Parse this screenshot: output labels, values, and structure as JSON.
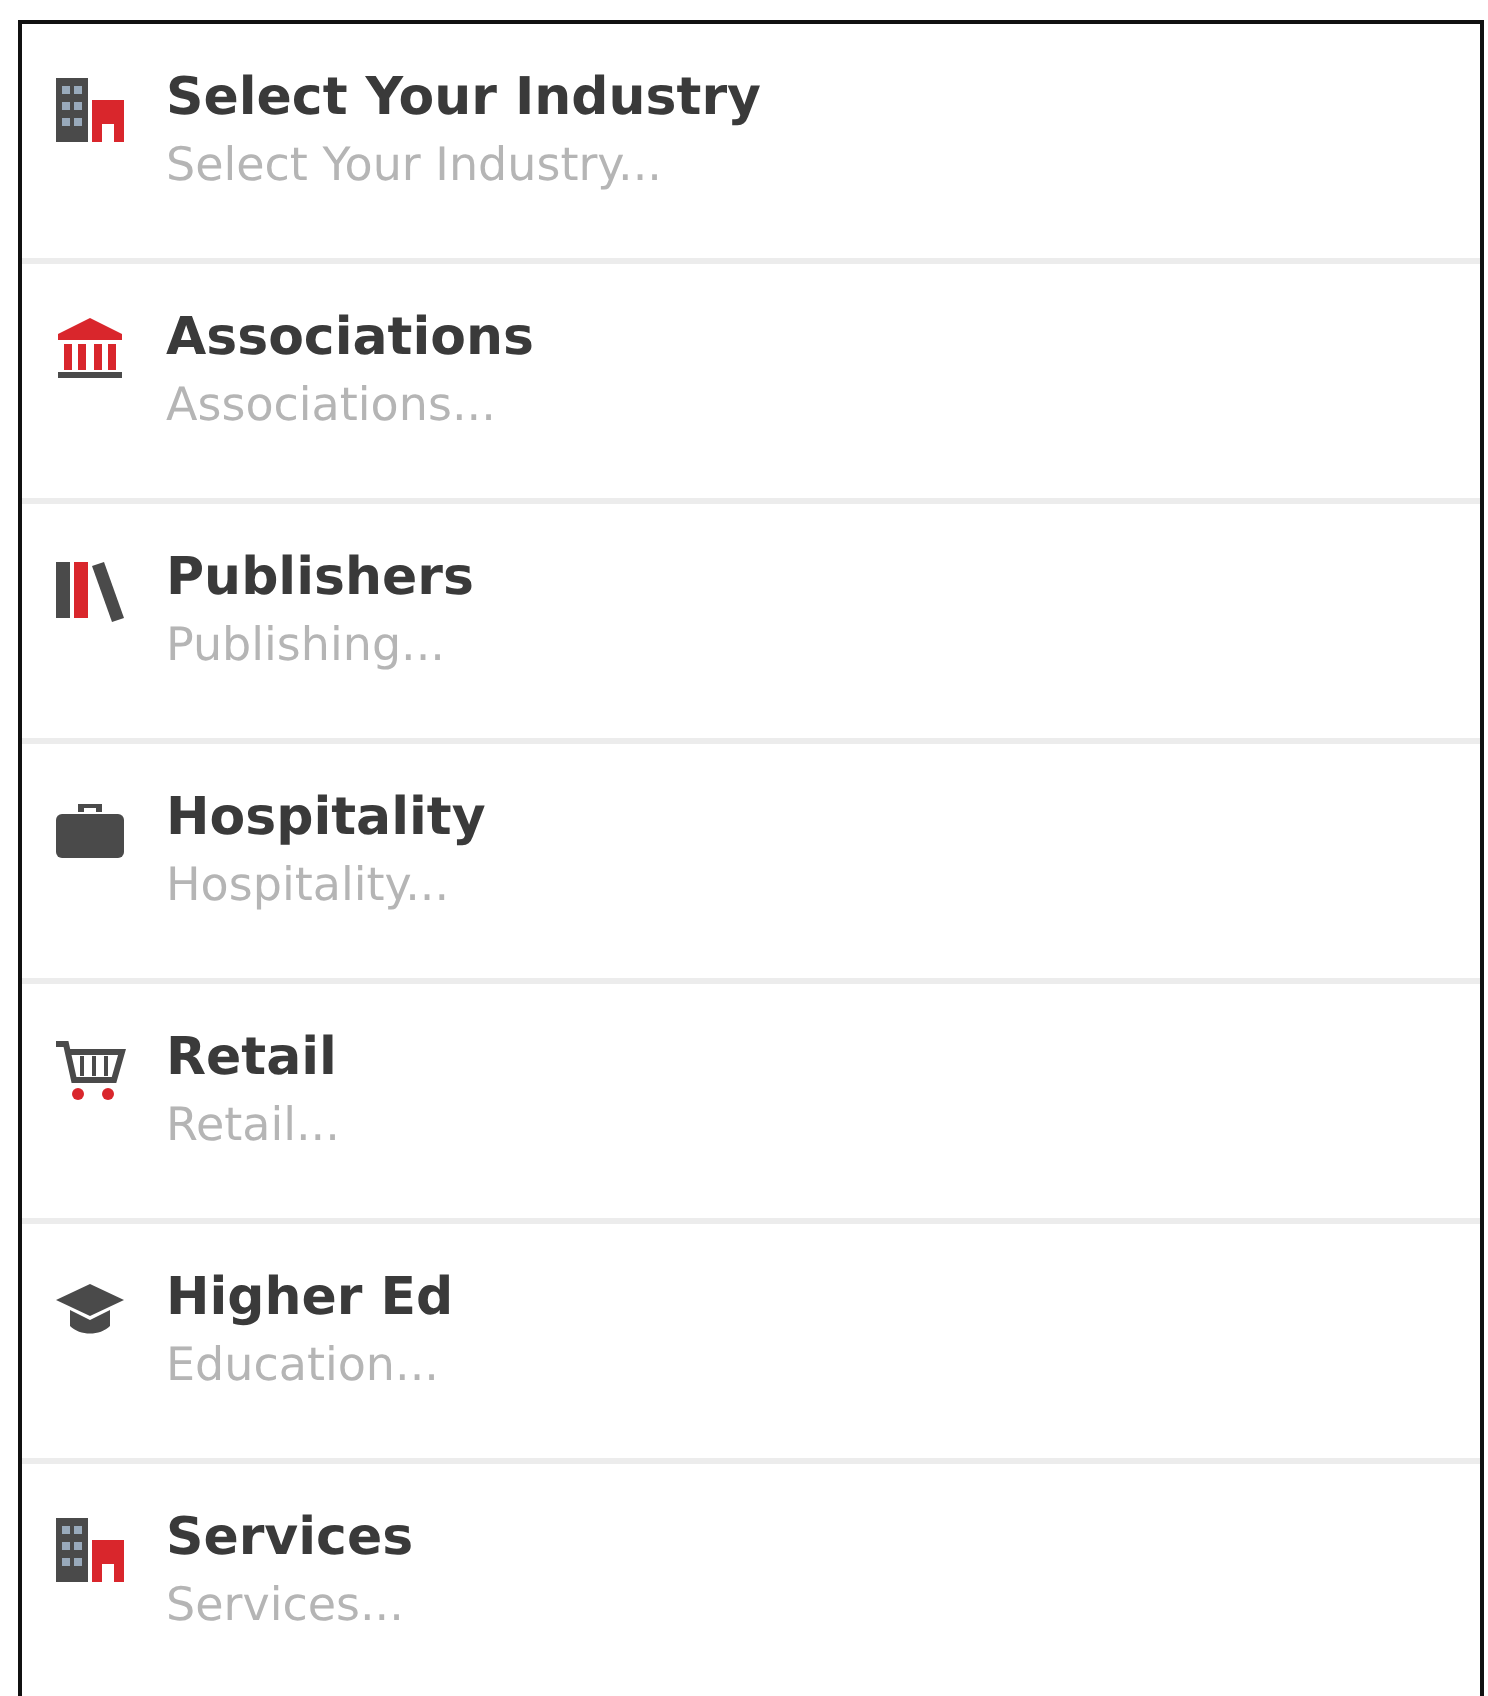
{
  "industries": [
    {
      "kind": "buildings",
      "title": "Select Your Industry",
      "subtitle": "Select Your Industry..."
    },
    {
      "kind": "bank",
      "title": "Associations",
      "subtitle": "Associations..."
    },
    {
      "kind": "books",
      "title": "Publishers",
      "subtitle": "Publishing..."
    },
    {
      "kind": "briefcase",
      "title": "Hospitality",
      "subtitle": "Hospitality..."
    },
    {
      "kind": "cart",
      "title": "Retail",
      "subtitle": "Retail..."
    },
    {
      "kind": "cap",
      "title": "Higher Ed",
      "subtitle": "Education..."
    },
    {
      "kind": "buildings",
      "title": "Services",
      "subtitle": "Services..."
    }
  ]
}
